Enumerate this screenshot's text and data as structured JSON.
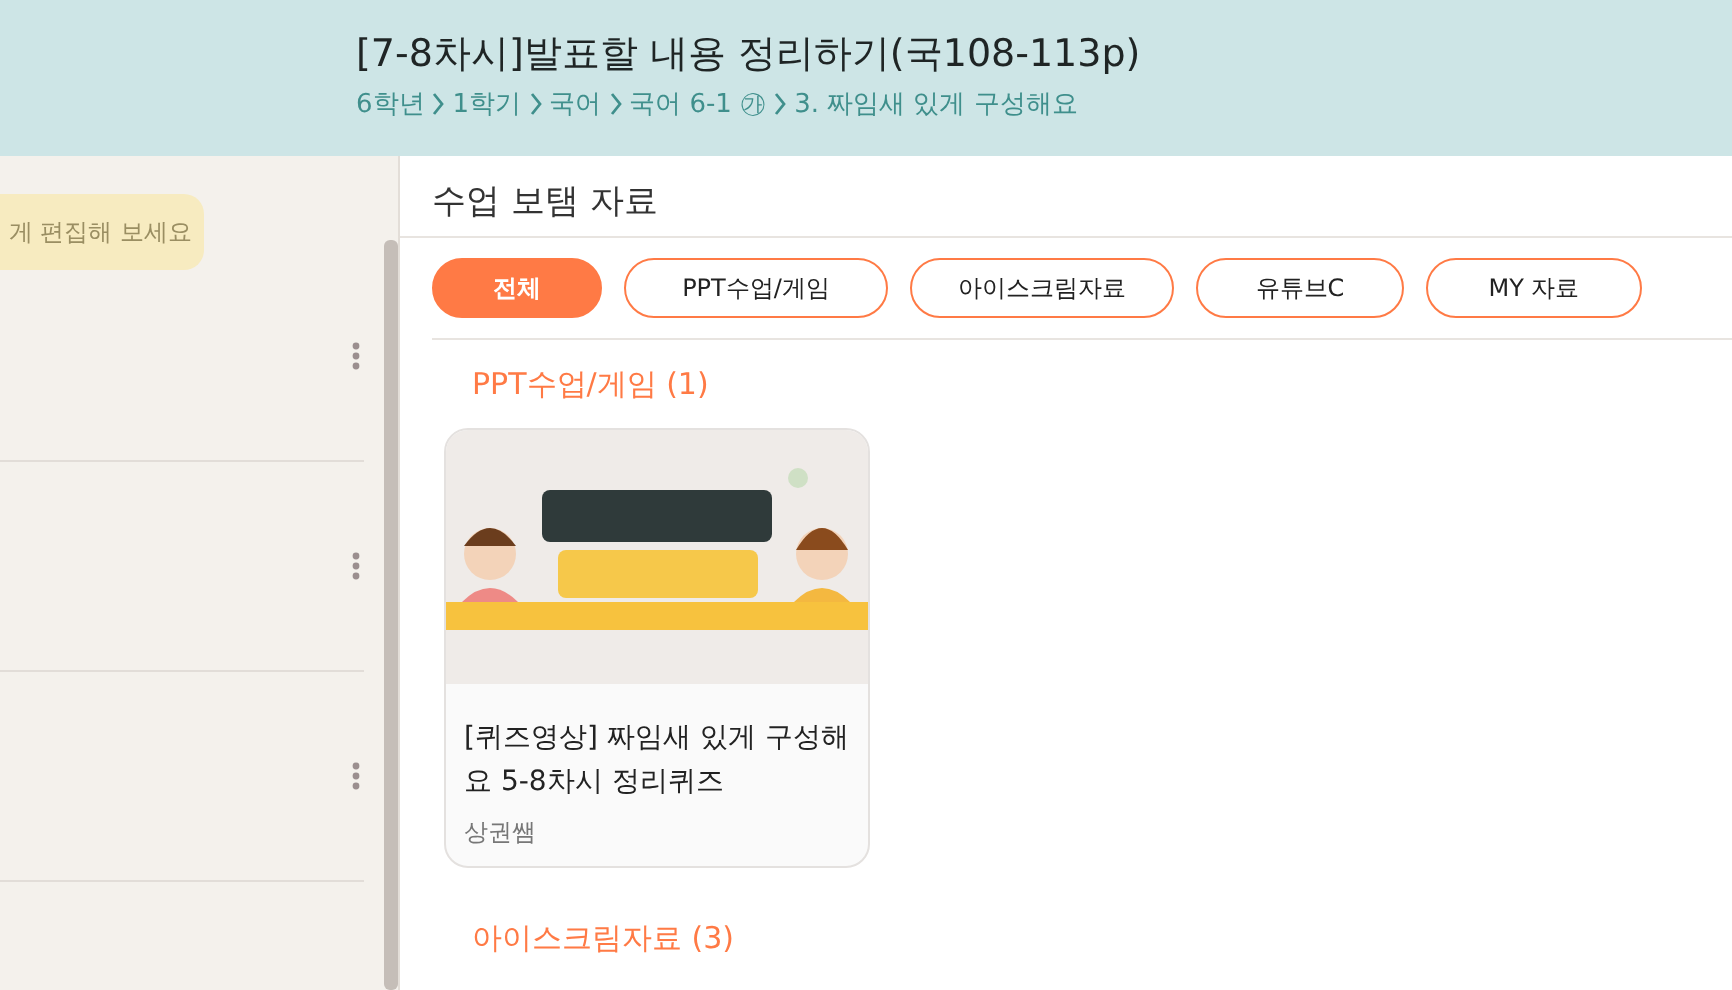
{
  "header": {
    "title": "[7-8차시]발표할 내용 정리하기(국108-113p)",
    "breadcrumb": [
      "6학년",
      "1학기",
      "국어",
      "국어 6-1 ㉮",
      "3. 짜임새 있게 구성해요"
    ]
  },
  "sidebar": {
    "tooltip": "게 편집해 보세요",
    "rows": [
      {},
      {},
      {}
    ]
  },
  "panel": {
    "title": "수업 보탬 자료",
    "filters": [
      {
        "label": "전체",
        "selected": true
      },
      {
        "label": "PPT수업/게임",
        "selected": false
      },
      {
        "label": "아이스크림자료",
        "selected": false
      },
      {
        "label": "유튜브C",
        "selected": false
      },
      {
        "label": "MY 자료",
        "selected": false
      }
    ],
    "sections": [
      {
        "heading": "PPT수업/게임 (1)",
        "cards": [
          {
            "title": "[퀴즈영상] 짜임새 있게 구성해요 5-8차시 정리퀴즈",
            "author": "상권쌤"
          }
        ]
      },
      {
        "heading": "아이스크림자료 (3)"
      }
    ]
  }
}
